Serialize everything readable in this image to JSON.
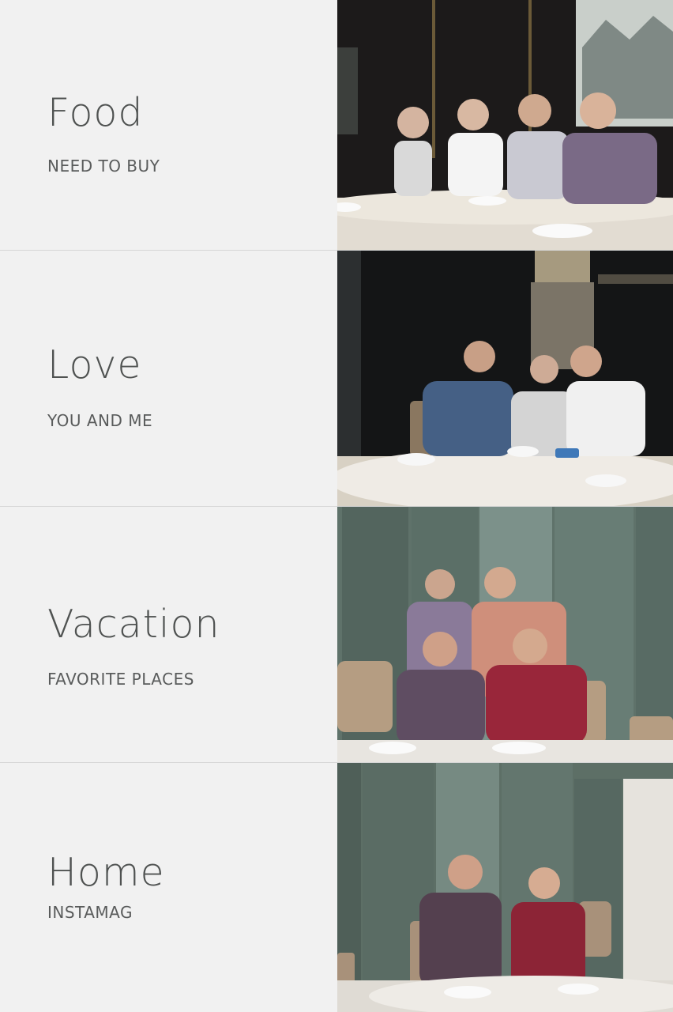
{
  "sections": [
    {
      "title": "Food",
      "subtitle": "NEED TO BUY",
      "photo": "dinner-table-group-photo"
    },
    {
      "title": "Love",
      "subtitle": "YOU AND ME",
      "photo": "restaurant-family-photo"
    },
    {
      "title": "Vacation",
      "subtitle": "FAVORITE PLACES",
      "photo": "family-portrait-photo"
    },
    {
      "title": "Home",
      "subtitle": "INSTAMAG",
      "photo": "two-men-seated-photo"
    }
  ],
  "colors": {
    "background": "#f1f1f1",
    "title_text": "#4f5251",
    "subtitle_text": "#595b5b"
  }
}
